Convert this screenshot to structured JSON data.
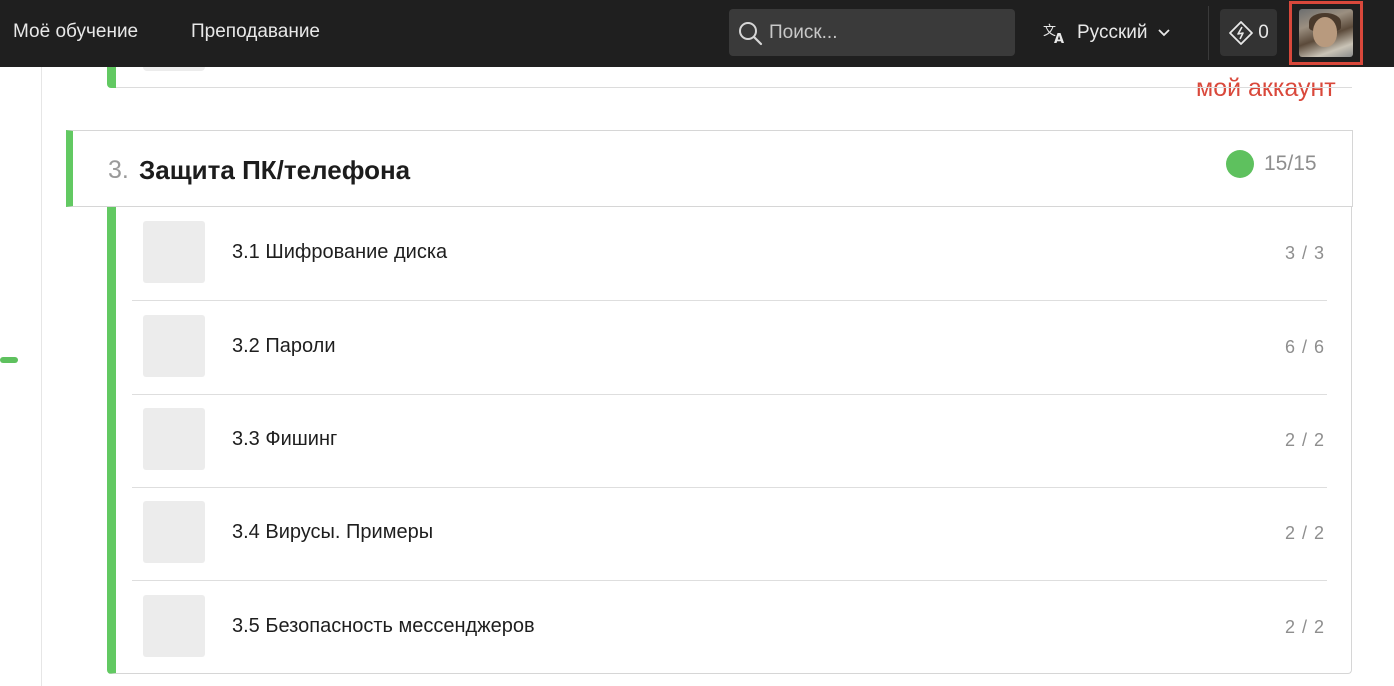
{
  "nav": {
    "my_learning": "Моё обучение",
    "teaching": "Преподавание",
    "search_placeholder": "Поиск...",
    "language": "Русский",
    "energy_count": "0"
  },
  "annotation": {
    "account_label": "мой аккаунт"
  },
  "section": {
    "number": "3.",
    "title": "Защита ПК/телефона",
    "score": "15/15",
    "status_color": "#5ec15e"
  },
  "lessons": [
    {
      "title": "3.1 Шифрование диска",
      "score": "3 / 3"
    },
    {
      "title": "3.2 Пароли",
      "score": "6 / 6"
    },
    {
      "title": "3.3 Фишинг",
      "score": "2 / 2"
    },
    {
      "title": "3.4 Вирусы. Примеры",
      "score": "2 / 2"
    },
    {
      "title": "3.5 Безопасность мессенджеров",
      "score": "2 / 2"
    }
  ],
  "colors": {
    "accent_green": "#62c962",
    "topbar": "#1f1f1f",
    "annotation_red": "#d9483b"
  },
  "icons": [
    "search-icon",
    "translate-icon",
    "chevron-down-icon",
    "energy-icon",
    "avatar"
  ]
}
